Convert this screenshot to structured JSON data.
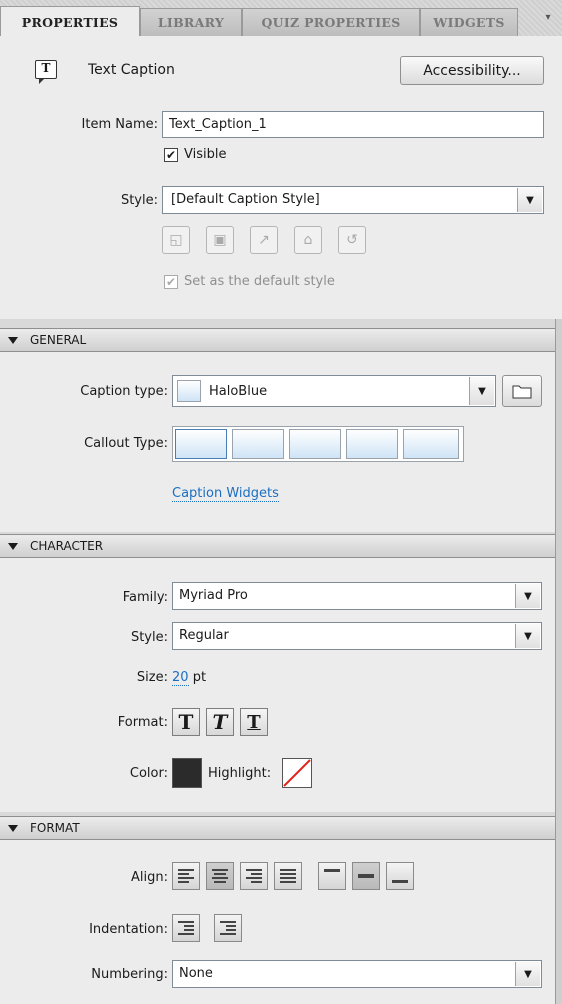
{
  "tabs": [
    "PROPERTIES",
    "LIBRARY",
    "QUIZ PROPERTIES",
    "WIDGETS"
  ],
  "header": {
    "object_type": "Text Caption",
    "accessibility_label": "Accessibility..."
  },
  "item_name": {
    "label": "Item Name:",
    "value": "Text_Caption_1"
  },
  "visible": {
    "label": "Visible",
    "checked": true
  },
  "style": {
    "label": "Style:",
    "value": "[Default Caption Style]",
    "default_checkbox_label": "Set as the default style"
  },
  "general": {
    "title": "GENERAL",
    "caption_type_label": "Caption type:",
    "caption_type_value": "HaloBlue",
    "callout_type_label": "Callout Type:",
    "caption_widgets_link": "Caption Widgets"
  },
  "character": {
    "title": "CHARACTER",
    "family_label": "Family:",
    "family_value": "Myriad Pro",
    "style_label": "Style:",
    "style_value": "Regular",
    "size_label": "Size:",
    "size_value": "20",
    "size_unit": "pt",
    "format_label": "Format:",
    "format_buttons": [
      "T",
      "T",
      "T"
    ],
    "color_label": "Color:",
    "highlight_label": "Highlight:",
    "color_swatch": "#2b2b2b"
  },
  "format": {
    "title": "FORMAT",
    "align_label": "Align:",
    "indentation_label": "Indentation:",
    "numbering_label": "Numbering:",
    "numbering_value": "None"
  },
  "colors": {
    "tab_active": "#ececec",
    "link": "#1b6fc2"
  }
}
